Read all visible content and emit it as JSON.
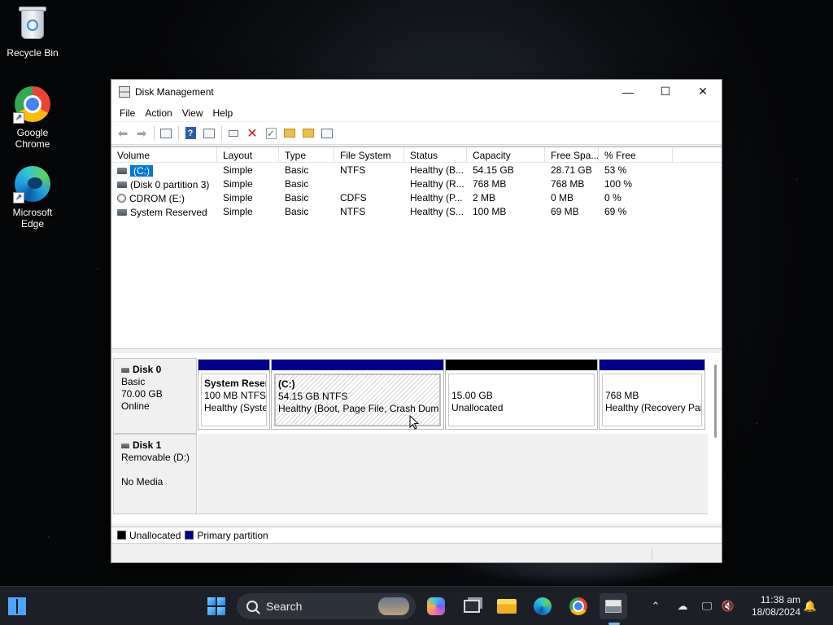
{
  "desktop": {
    "icons": [
      {
        "label": "Recycle Bin"
      },
      {
        "label": "Google Chrome"
      },
      {
        "label": "Microsoft Edge"
      }
    ]
  },
  "window": {
    "title": "Disk Management",
    "controls": {
      "minimize": "—",
      "maximize": "☐",
      "close": "✕"
    },
    "menu": [
      "File",
      "Action",
      "View",
      "Help"
    ]
  },
  "volume_table": {
    "columns": [
      "Volume",
      "Layout",
      "Type",
      "File System",
      "Status",
      "Capacity",
      "Free Spa...",
      "% Free"
    ],
    "rows": [
      {
        "volume": "(C:)",
        "layout": "Simple",
        "type": "Basic",
        "fs": "NTFS",
        "status": "Healthy (B...",
        "capacity": "54.15 GB",
        "free": "28.71 GB",
        "pct": "53 %",
        "icon": "drive-icon",
        "selected": true
      },
      {
        "volume": "(Disk 0 partition 3)",
        "layout": "Simple",
        "type": "Basic",
        "fs": "",
        "status": "Healthy (R...",
        "capacity": "768 MB",
        "free": "768 MB",
        "pct": "100 %",
        "icon": "drive-icon",
        "selected": false
      },
      {
        "volume": "CDROM (E:)",
        "layout": "Simple",
        "type": "Basic",
        "fs": "CDFS",
        "status": "Healthy (P...",
        "capacity": "2 MB",
        "free": "0 MB",
        "pct": "0 %",
        "icon": "cdrom-icon",
        "selected": false
      },
      {
        "volume": "System Reserved",
        "layout": "Simple",
        "type": "Basic",
        "fs": "NTFS",
        "status": "Healthy (S...",
        "capacity": "100 MB",
        "free": "69 MB",
        "pct": "69 %",
        "icon": "drive-icon",
        "selected": false
      }
    ]
  },
  "disks": [
    {
      "name": "Disk 0",
      "kind": "Basic",
      "size": "70.00 GB",
      "state": "Online",
      "partitions": [
        {
          "name": "System Reser",
          "line1": "100 MB NTFS",
          "line2": "Healthy (Syste",
          "kind": "primary"
        },
        {
          "name": "(C:)",
          "line1": "54.15 GB NTFS",
          "line2": "Healthy (Boot, Page File, Crash Dump",
          "kind": "primary"
        },
        {
          "name": "",
          "line1": "15.00 GB",
          "line2": "Unallocated",
          "kind": "unallocated"
        },
        {
          "name": "",
          "line1": "768 MB",
          "line2": "Healthy (Recovery Par",
          "kind": "primary"
        }
      ]
    },
    {
      "name": "Disk 1",
      "kind": "Removable (D:)",
      "size": "",
      "state": "No Media"
    }
  ],
  "legend": [
    {
      "label": "Unallocated",
      "color": "#000000"
    },
    {
      "label": "Primary partition",
      "color": "#000088"
    }
  ],
  "taskbar": {
    "search_placeholder": "Search",
    "time": "11:38 am",
    "date": "18/08/2024",
    "pinned": [
      "widgets-icon",
      "start-icon",
      "copilot-icon",
      "task-view-icon",
      "file-explorer-icon",
      "edge-icon",
      "chrome-icon",
      "disk-management-icon"
    ]
  }
}
